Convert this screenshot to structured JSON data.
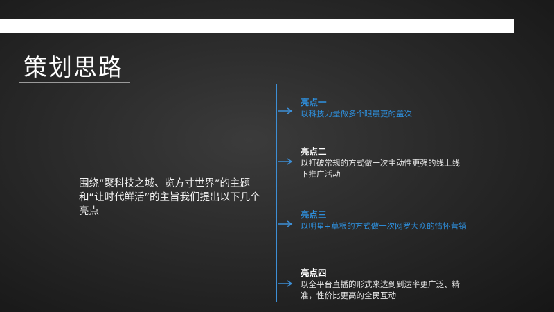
{
  "slide": {
    "title": "策划思路",
    "intro": "围绕“聚科技之城、览方寸世界”的主题和“让时代鲜活”的主旨我们提出以下几个亮点"
  },
  "points": [
    {
      "title": "亮点一",
      "desc": "以科技力量做多个眼晨更的盖次"
    },
    {
      "title": "亮点二",
      "desc": "以打破常规的方式做一次主动性更强的线上线下推广活动"
    },
    {
      "title": "亮点三",
      "desc": "以明星+草根的方式做一次网罗大众的情怀营销"
    },
    {
      "title": "亮点四",
      "desc": "以全平台直播的形式来达到到达率更广泛、精准，性价比更高的全民互动"
    }
  ],
  "colors": {
    "accent": "#2e8fdc",
    "timeline": "#3d8fd6",
    "background": "#2a2a2a"
  }
}
